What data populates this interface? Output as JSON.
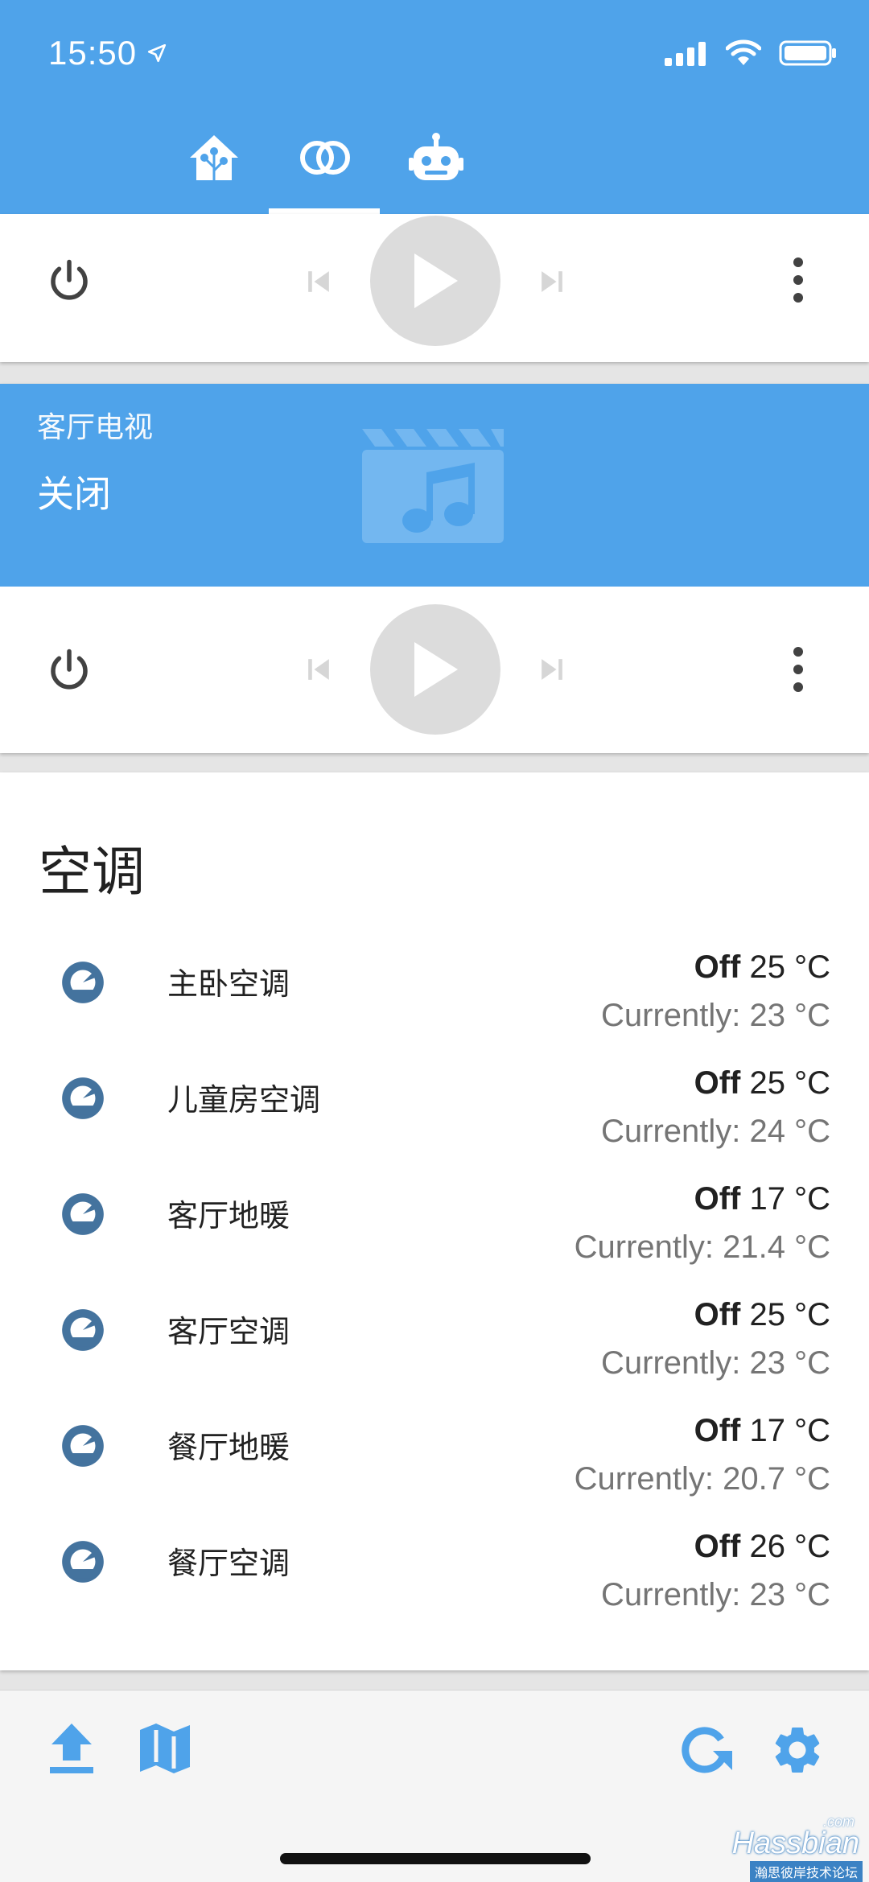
{
  "status_bar": {
    "time": "15:50"
  },
  "header": {
    "tabs": [
      {
        "name": "home",
        "icon": "home-assistant-icon",
        "active": false
      },
      {
        "name": "lovelace",
        "icon": "overlapping-circles-icon",
        "active": true
      },
      {
        "name": "automation",
        "icon": "robot-icon",
        "active": false
      }
    ]
  },
  "media_player_top": {
    "icons": [
      "power-icon",
      "skip-previous-icon",
      "play-icon",
      "skip-next-icon",
      "more-vertical-icon"
    ]
  },
  "media_player_tv": {
    "title": "客厅电视",
    "state": "关闭",
    "artwork_icon": "video-music-icon",
    "icons": [
      "power-icon",
      "skip-previous-icon",
      "play-icon",
      "skip-next-icon",
      "more-vertical-icon"
    ]
  },
  "climate": {
    "title": "空调",
    "items": [
      {
        "name": "主卧空调",
        "state": "Off",
        "target": "25 °C",
        "current": "Currently: 23 °C"
      },
      {
        "name": "儿童房空调",
        "state": "Off",
        "target": "25 °C",
        "current": "Currently: 24 °C"
      },
      {
        "name": "客厅地暖",
        "state": "Off",
        "target": "17 °C",
        "current": "Currently: 21.4 °C"
      },
      {
        "name": "客厅空调",
        "state": "Off",
        "target": "25 °C",
        "current": "Currently: 23 °C"
      },
      {
        "name": "餐厅地暖",
        "state": "Off",
        "target": "17 °C",
        "current": "Currently: 20.7 °C"
      },
      {
        "name": "餐厅空调",
        "state": "Off",
        "target": "26 °C",
        "current": "Currently: 23 °C"
      }
    ]
  },
  "toolbar": {
    "left": [
      "upload-icon",
      "map-icon"
    ],
    "right": [
      "refresh-icon",
      "gear-icon"
    ]
  },
  "watermark": {
    "text": "Hassbian",
    "suffix": ".com",
    "subtitle": "瀚思彼岸技术论坛"
  },
  "colors": {
    "header": "#4fa3ea",
    "accent": "#4fa3ea",
    "thermostat_icon": "#44739e",
    "secondary_text": "#757575"
  }
}
